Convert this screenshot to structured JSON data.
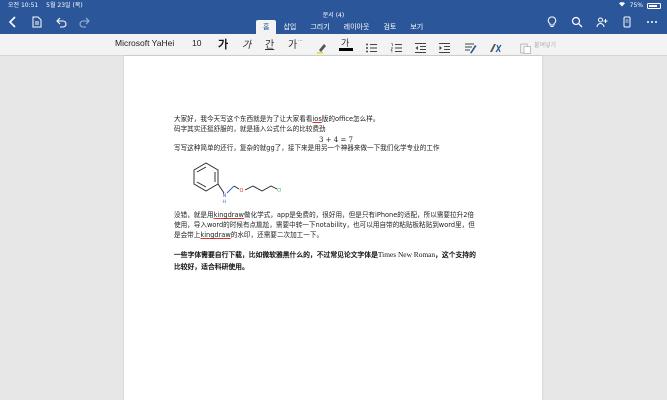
{
  "status": {
    "time": "오전 10:51",
    "date": "5월 23일 (목)",
    "battery": "75%",
    "battery_level": 0.75
  },
  "window": {
    "title": "문서 (4)"
  },
  "ribbon": {
    "tabs": [
      {
        "label": "홈",
        "active": true
      },
      {
        "label": "삽입",
        "active": false
      },
      {
        "label": "그리기",
        "active": false
      },
      {
        "label": "레이아웃",
        "active": false
      },
      {
        "label": "검토",
        "active": false
      },
      {
        "label": "보기",
        "active": false
      }
    ]
  },
  "toolbar": {
    "font_name": "Microsoft YaHei",
    "font_size": "10",
    "bold": "가",
    "italic": "가",
    "underline": "간",
    "strike": "가",
    "font_color_glyph": "가",
    "paste_label": "붙여넣기"
  },
  "document": {
    "line1_a": "大家好，我今天写这个东西就是为了让大家看看",
    "line1_link": "ios",
    "line1_b": "版的office怎么样。",
    "line2": "码字其实还挺舒服的，就是插入公式什么的比较费劲",
    "formula": "3 + 4 = 7",
    "line3": "写写这种简单的还行，复杂的就gg了，接下来是用另一个神器来做一下我们化学专业的工作",
    "molecule_labels": {
      "n": "N",
      "h": "H",
      "o": "O",
      "cl": "Cl"
    },
    "p2_line1_a": "没错，就是用",
    "p2_line1_link": "kingdraw",
    "p2_line1_b": "做化学式，app是免费的，很好用，但是只有iPhone的适配，所以需要拉升2倍",
    "p2_line2": "使用，导入word的时候有点尴尬，需要中转一下notability，也可以用自带的粘贴板粘贴到word里，但",
    "p2_line3_a": "是会带上",
    "p2_line3_link": "kingdraw",
    "p2_line3_b": "的水印，还需要二次加工一下。",
    "p3_line1_a": "一些字体需要自行下载，比如微软雅黑什么的，不过常见论文字体是",
    "p3_line1_serif": "Times New Roman",
    "p3_line1_b": "，这个支持的",
    "p3_line2": "比较好，适合科研使用。"
  }
}
